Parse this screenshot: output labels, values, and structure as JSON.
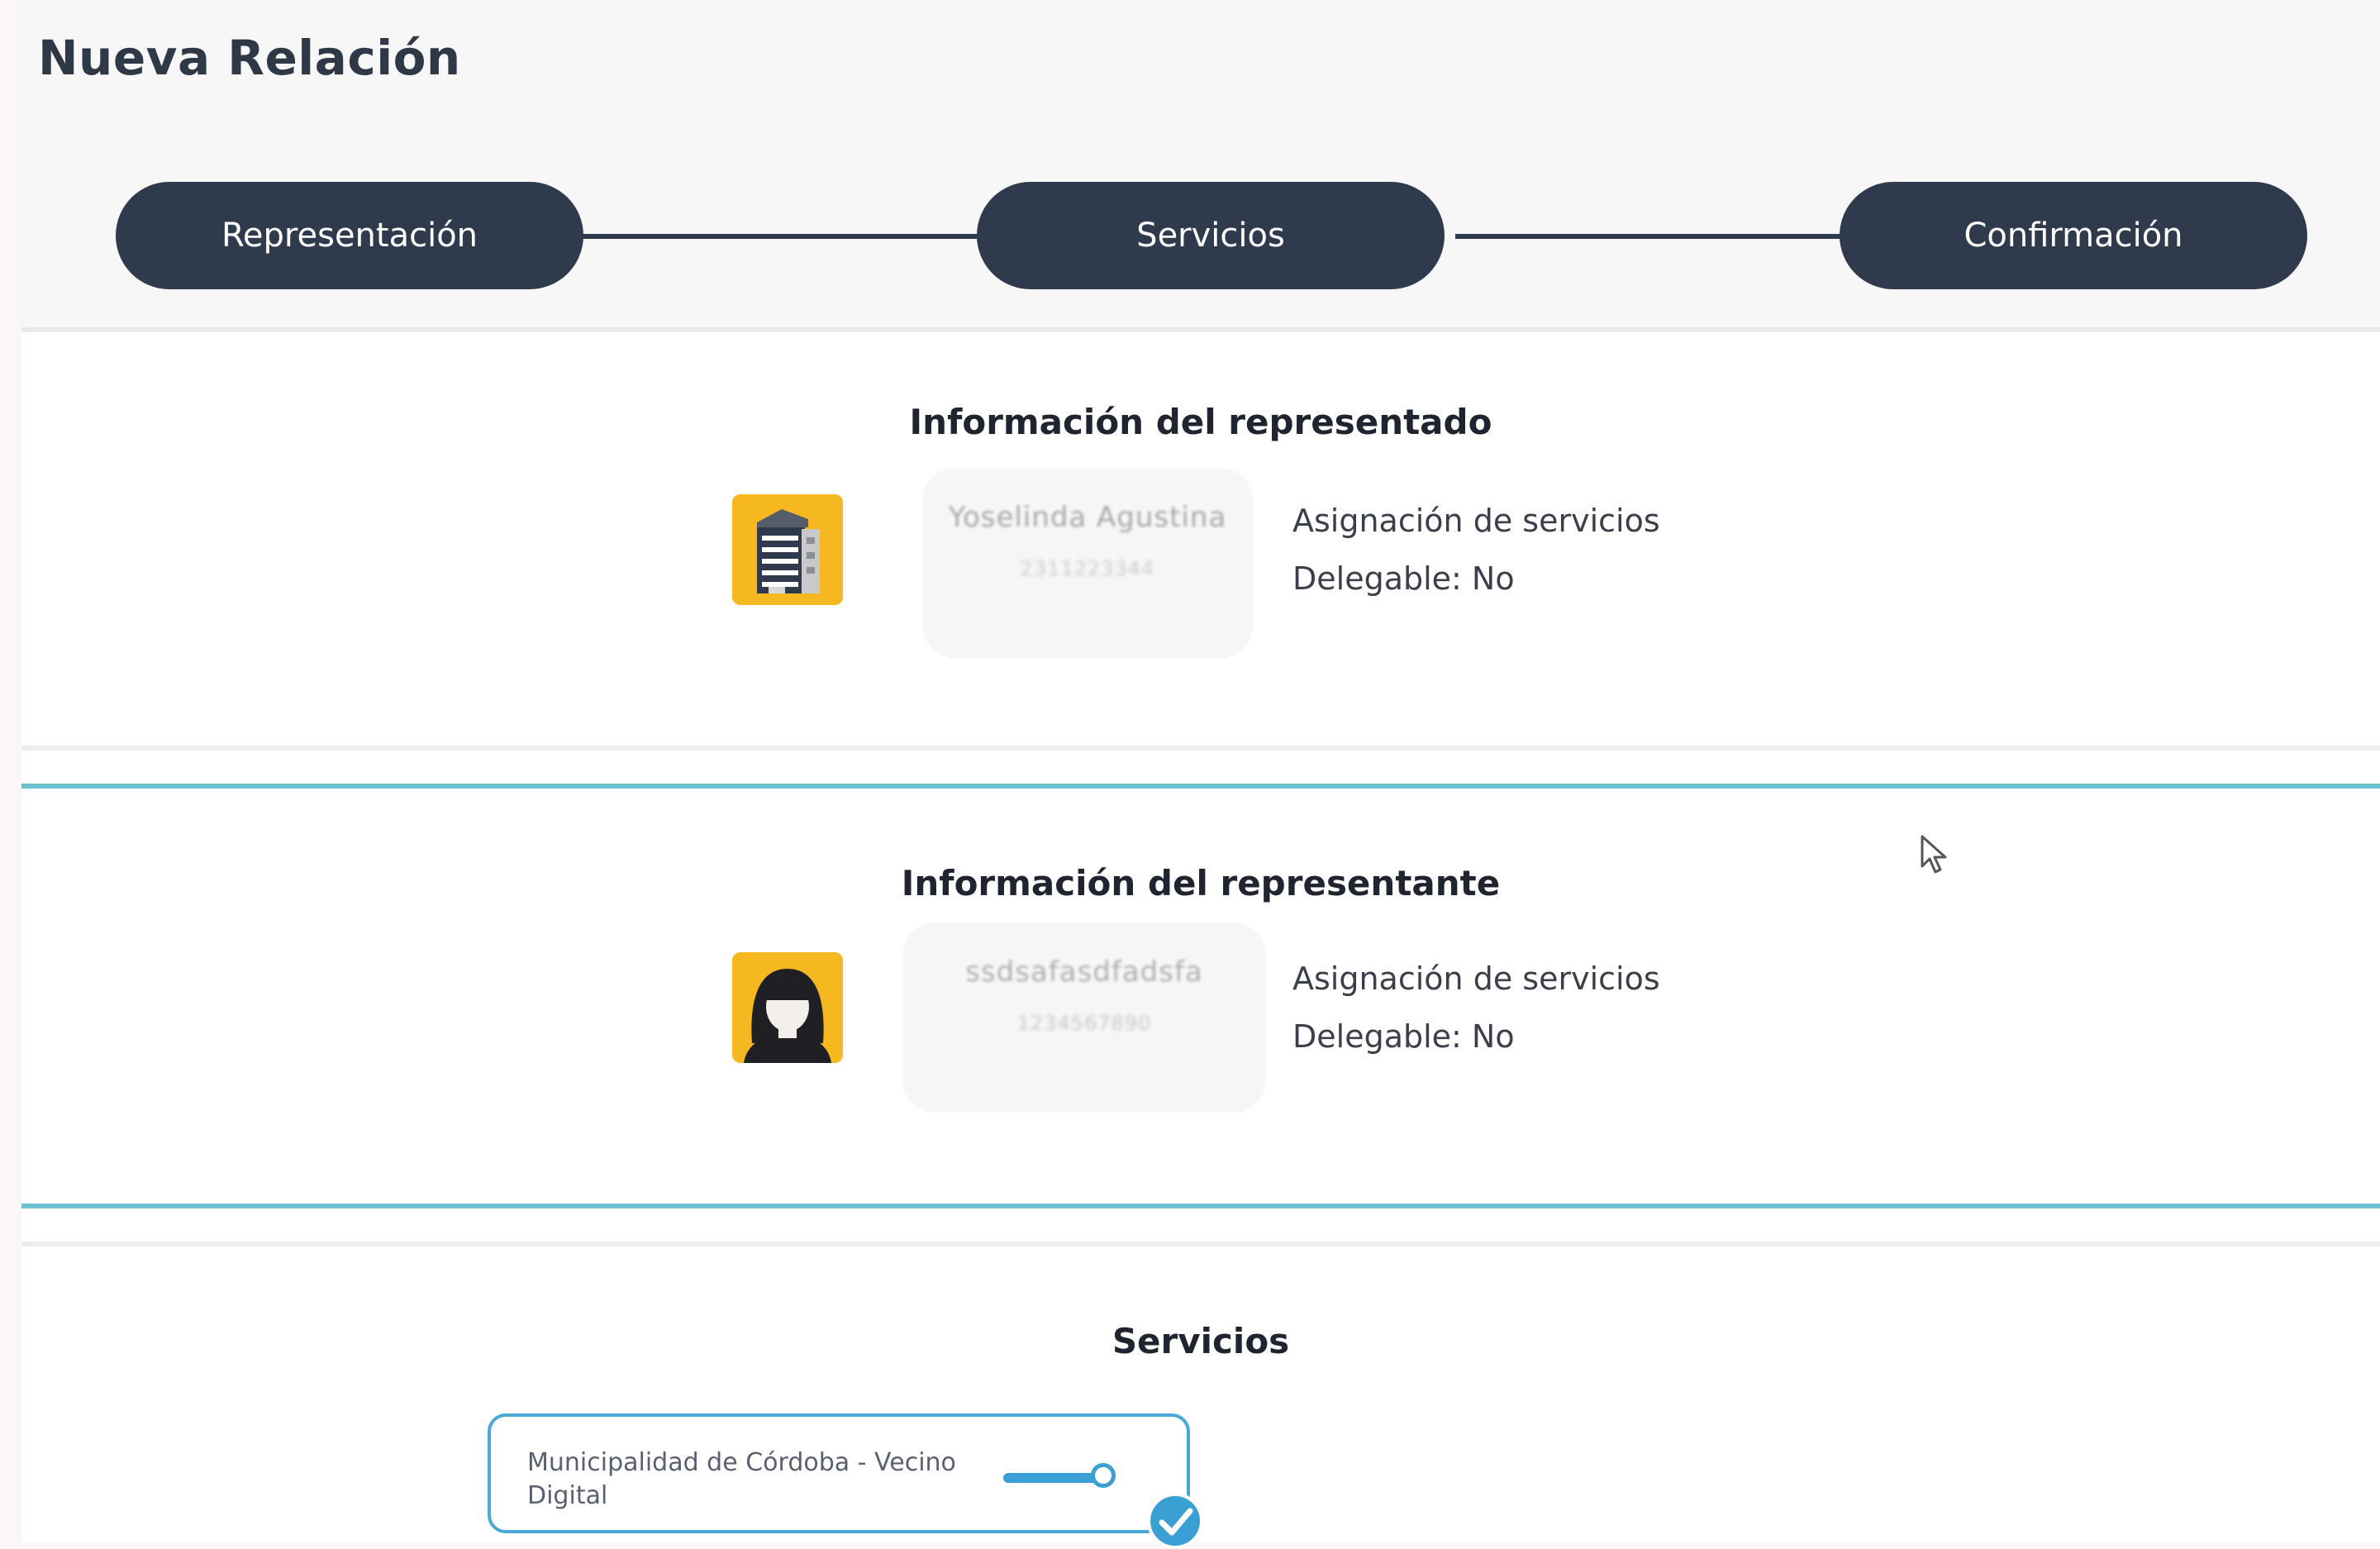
{
  "page_title": "Nueva Relación",
  "stepper": {
    "steps": [
      "Representación",
      "Servicios",
      "Confirmación"
    ]
  },
  "represented": {
    "title": "Información del representado",
    "avatar_icon": "building-icon",
    "name_redacted": "Yoselinda Agustina",
    "id_redacted": "2311223344",
    "assignment_label": "Asignación de servicios",
    "delegable_label": "Delegable: No"
  },
  "representative": {
    "title": "Información del representante",
    "avatar_icon": "woman-avatar-icon",
    "name_redacted": "ssdsafasdfadsfa",
    "id_redacted": "1234567890",
    "assignment_label": "Asignación de servicios",
    "delegable_label": "Delegable: No"
  },
  "services": {
    "title": "Servicios",
    "items": [
      {
        "label": "Municipalidad de Córdoba - Vecino Digital",
        "enabled": true,
        "checked": true
      }
    ]
  },
  "colors": {
    "primary_dark": "#2f3a4c",
    "accent_teal": "#6cc0cf",
    "accent_blue": "#3a9fd2",
    "avatar_yellow": "#f5b820"
  }
}
